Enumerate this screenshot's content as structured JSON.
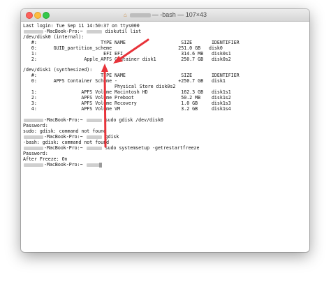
{
  "window": {
    "title_suffix": "— -bash — 107×43",
    "title_prefix": "—"
  },
  "terminal": {
    "lines": [
      "Last login: Tue Sep 11 14:50:37 on ttys000",
      "-MacBook-Pro:~ ",
      "/dev/disk0 (internal):",
      "   #:                       TYPE NAME                    SIZE       IDENTIFIER",
      "   0:      GUID_partition_scheme                        251.0 GB   disk0",
      "   1:                        EFI EFI                     314.6 MB   disk0s1",
      "   2:                 Apple_APFS Container disk1         250.7 GB   disk0s2",
      "/dev/disk1 (synthesized):",
      "   #:                       TYPE NAME                    SIZE       IDENTIFIER",
      "   0:      APFS Container Scheme -                      +250.7 GB   disk1",
      "                                 Physical Store disk0s2",
      "   1:                APFS Volume Macintosh HD            162.3 GB   disk1s1",
      "   2:                APFS Volume Preboot                 50.2 MB    disk1s2",
      "   3:                APFS Volume Recovery                1.0 GB     disk1s3",
      "   4:                APFS Volume VM                      3.2 GB     disk1s4",
      "-MacBook-Pro:~ ",
      "Password:",
      "sudo: gdisk: command not found",
      "-MacBook-Pro:~ ",
      "-bash: gdisk: command not found",
      "-MacBook-Pro:~ ",
      "Password:",
      "After Freeze: On",
      "-MacBook-Pro:~ "
    ],
    "commands": {
      "diskutil": " diskutil list",
      "gdisk_sudo": " sudo gdisk /dev/disk0",
      "gdisk": " gdisk",
      "systemsetup": " sudo systemsetup -getrestartfreeze"
    }
  },
  "annotation": {
    "arrow_color": "#e8333a"
  }
}
